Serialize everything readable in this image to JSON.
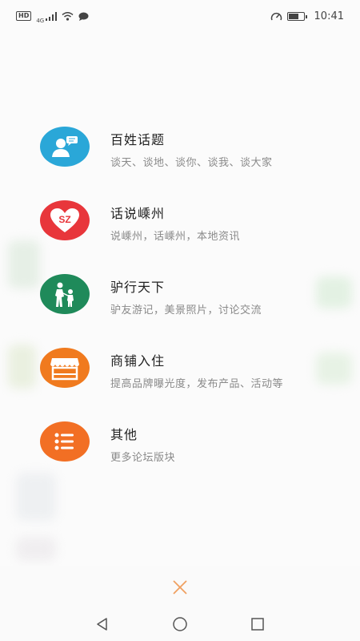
{
  "status_bar": {
    "hd": "HD",
    "network": "4G",
    "time": "10:41",
    "icons": [
      "signal-icon",
      "wifi-icon",
      "message-icon",
      "speed-icon",
      "battery-icon"
    ]
  },
  "menu": {
    "items": [
      {
        "title": "百姓话题",
        "subtitle": "谈天、谈地、谈你、谈我、谈大家",
        "icon": "user-chat-icon",
        "color": "#2aa7d8",
        "icon_text": ""
      },
      {
        "title": "话说嵊州",
        "subtitle": "说嵊州，话嵊州，本地资讯",
        "icon": "heart-sz-icon",
        "color": "#e8363b",
        "icon_text": "SZ"
      },
      {
        "title": "驴行天下",
        "subtitle": "驴友游记，美景照片，讨论交流",
        "icon": "hikers-icon",
        "color": "#1f8a5a",
        "icon_text": ""
      },
      {
        "title": "商铺入住",
        "subtitle": "提高品牌曝光度，发布产品、活动等",
        "icon": "storefront-icon",
        "color": "#f07a1e",
        "icon_text": ""
      },
      {
        "title": "其他",
        "subtitle": "更多论坛版块",
        "icon": "list-icon",
        "color": "#f26f24",
        "icon_text": ""
      }
    ]
  },
  "bottom": {
    "close_icon": "close-icon",
    "accent": "#f0a060"
  },
  "nav": {
    "back": "back-icon",
    "home": "home-icon",
    "recent": "recent-apps-icon"
  }
}
